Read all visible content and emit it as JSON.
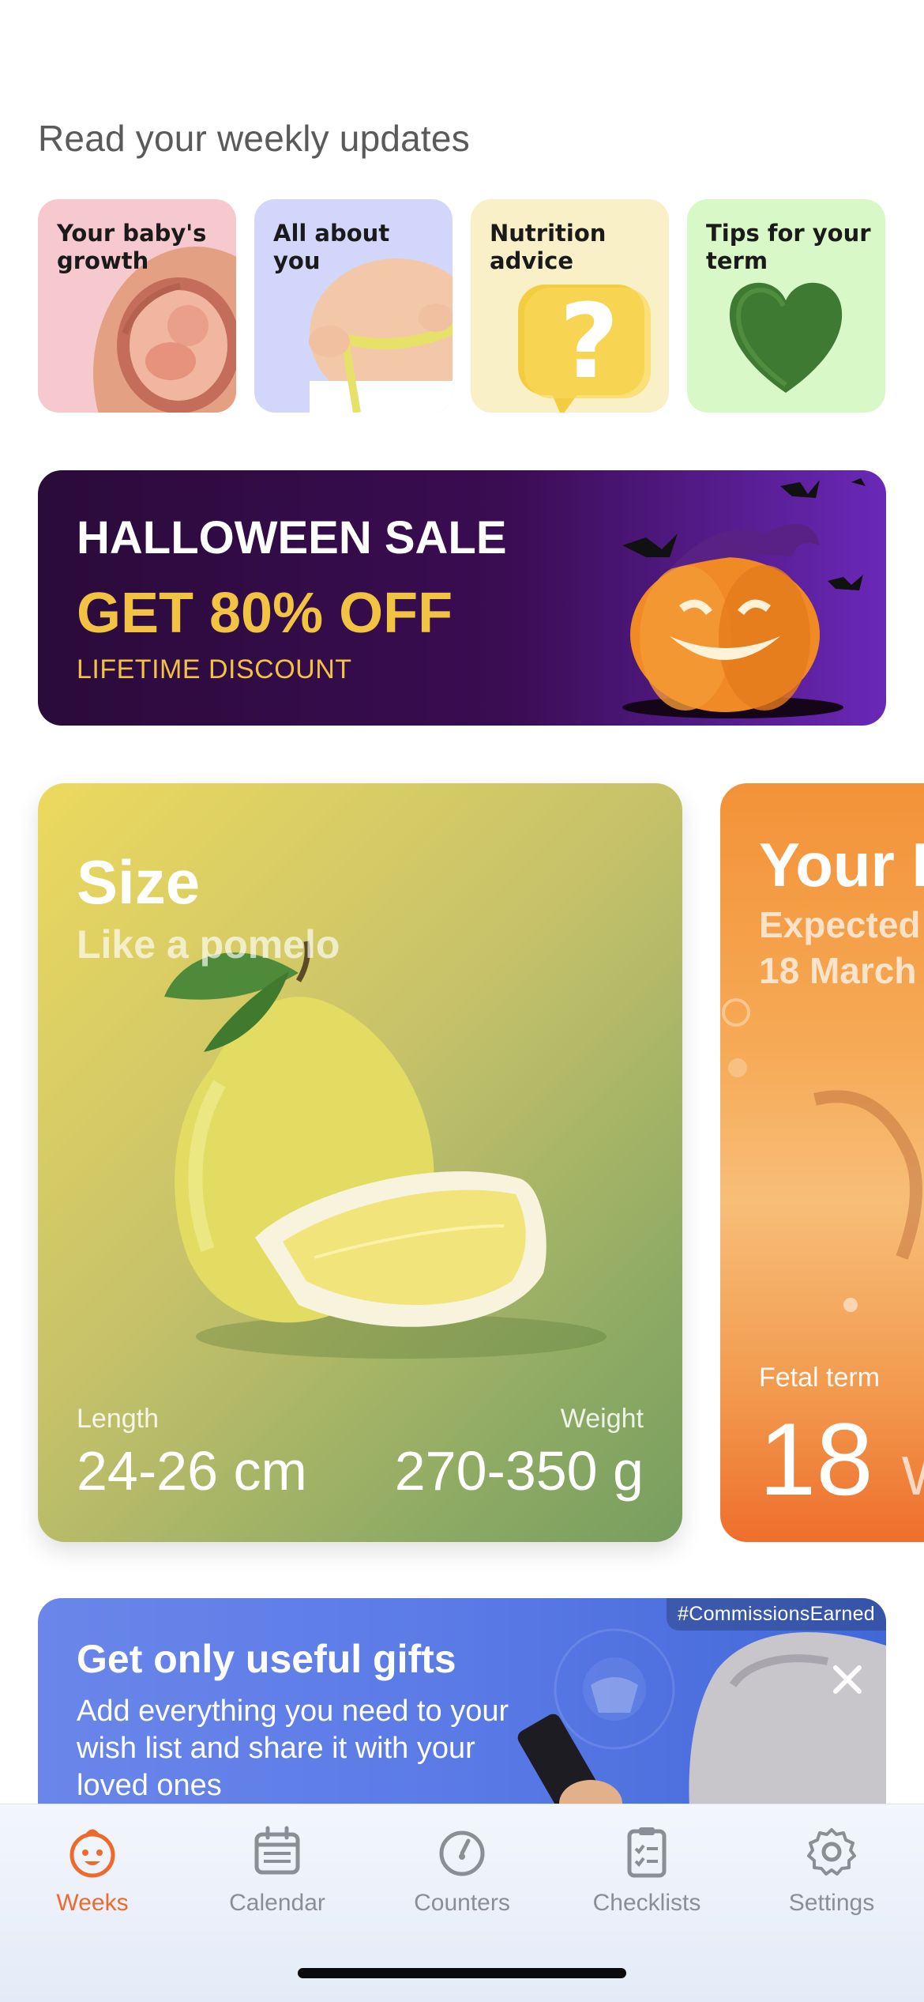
{
  "updates": {
    "title": "Read your weekly updates",
    "cards": [
      {
        "label": "Your baby's growth",
        "color": "#f6c9cf"
      },
      {
        "label": "All about you",
        "color": "#d3d6fb"
      },
      {
        "label": "Nutrition advice",
        "color": "#faf0c8"
      },
      {
        "label": "Tips for your term",
        "color": "#d8f8c8"
      }
    ]
  },
  "promo": {
    "title": "HALLOWEEN SALE",
    "offer": "GET 80% OFF",
    "subtitle": "LIFETIME DISCOUNT"
  },
  "size_card": {
    "title": "Size",
    "subtitle": "Like a pomelo",
    "length_label": "Length",
    "length_value": "24-26 cm",
    "weight_label": "Weight",
    "weight_value": "270-350 g"
  },
  "due_card": {
    "title": "Your I",
    "subtitle_line1": "Expected",
    "subtitle_line2": "18 March",
    "term_label": "Fetal term",
    "term_value": "18",
    "term_unit": "W"
  },
  "gifts_ad": {
    "title": "Get only useful gifts",
    "body": "Add everything you need to your wish list and share it with your loved ones",
    "tag": "#CommissionsEarned"
  },
  "tabbar": {
    "tabs": [
      {
        "label": "Weeks",
        "icon": "baby-face-icon",
        "active": true
      },
      {
        "label": "Calendar",
        "icon": "calendar-icon",
        "active": false
      },
      {
        "label": "Counters",
        "icon": "counter-gauge-icon",
        "active": false
      },
      {
        "label": "Checklists",
        "icon": "checklist-icon",
        "active": false
      },
      {
        "label": "Settings",
        "icon": "gear-icon",
        "active": false
      }
    ],
    "active_color": "#ee6a2c",
    "inactive_color": "#8a8e96"
  }
}
